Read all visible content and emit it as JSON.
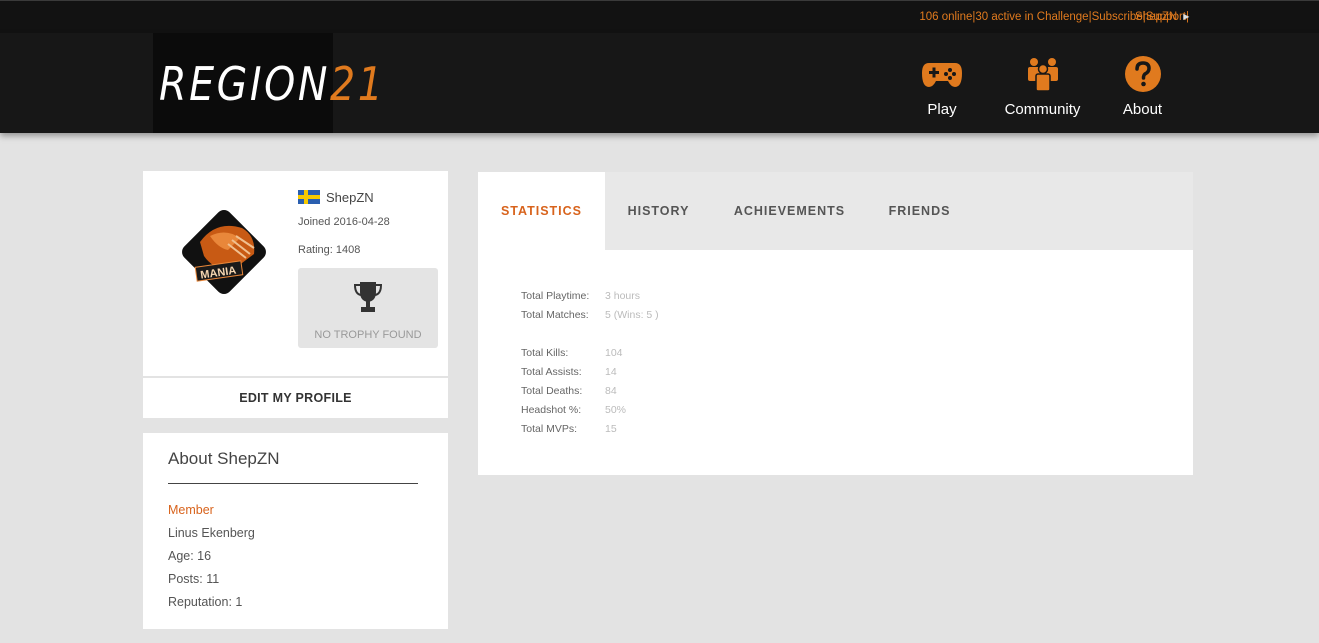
{
  "topbar": {
    "online": "106 online",
    "challenge": "30 active in Challenge",
    "subscribe": "Subscribe",
    "support": "Support",
    "username": "ShepZN",
    "separator": "|"
  },
  "header": {
    "logo_text": "REGION",
    "logo_number": "21",
    "nav": [
      {
        "label": "Play",
        "icon": "gamepad-icon"
      },
      {
        "label": "Community",
        "icon": "community-icon"
      },
      {
        "label": "About",
        "icon": "question-icon"
      }
    ]
  },
  "profile": {
    "name": "ShepZN",
    "country_flag": "sweden-flag-icon",
    "joined": "Joined 2016-04-28",
    "rating": "Rating: 1408",
    "trophy_text": "NO TROPHY FOUND",
    "edit_label": "EDIT MY PROFILE"
  },
  "about": {
    "title": "About ShepZN",
    "role": "Member",
    "real_name": "Linus Ekenberg",
    "age": "Age: 16",
    "posts": "Posts: 11",
    "reputation": "Reputation: 1"
  },
  "tabs": [
    {
      "label": "STATISTICS",
      "active": true
    },
    {
      "label": "HISTORY",
      "active": false
    },
    {
      "label": "ACHIEVEMENTS",
      "active": false
    },
    {
      "label": "FRIENDS",
      "active": false
    }
  ],
  "stats": {
    "playtime_label": "Total Playtime:",
    "playtime": "3 hours",
    "matches_label": "Total Matches:",
    "matches": "5 (Wins: 5 )",
    "kills_label": "Total Kills:",
    "kills": "104",
    "assists_label": "Total Assists:",
    "assists": "14",
    "deaths_label": "Total Deaths:",
    "deaths": "84",
    "headshot_label": "Headshot %:",
    "headshot": "50%",
    "mvps_label": "Total MVPs:",
    "mvps": "15"
  },
  "colors": {
    "accent": "#e07a1e",
    "active_tab": "#d8631c",
    "header_bg": "#171717",
    "page_bg": "#e3e3e3"
  }
}
